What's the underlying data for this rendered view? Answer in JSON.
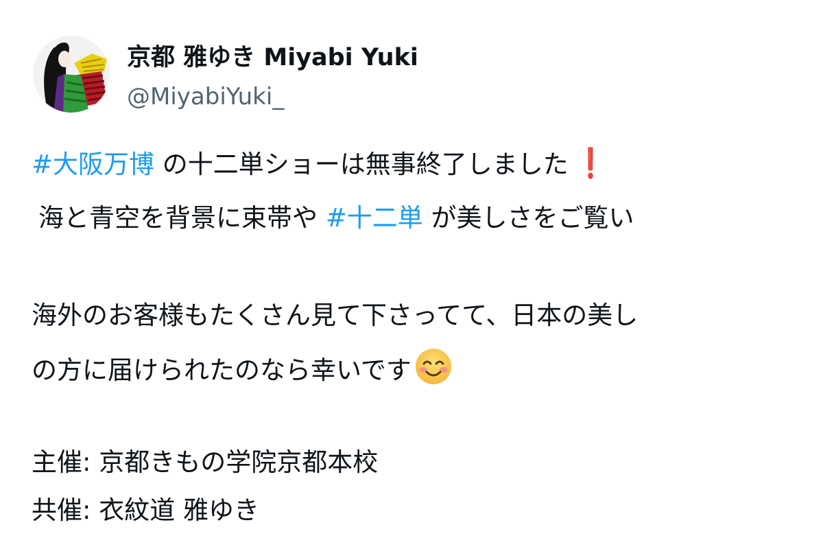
{
  "author": {
    "display_name": "京都 雅ゆき Miyabi Yuki",
    "handle": "@MiyabiYuki_"
  },
  "tweet": {
    "line1": {
      "hashtag": "#大阪万博",
      "text": " の十二単ショーは無事終了しました",
      "emoji": "❗"
    },
    "line2": {
      "text_before": "海と青空を背景に束帯や ",
      "hashtag": "#十二単",
      "text_after": " が美しさをご覧い"
    },
    "line3": "海外のお客様もたくさん見て下さってて、日本の美し",
    "line4": {
      "text": "の方に届けられたのなら幸いです",
      "emoji": "smiling-face-emoji"
    },
    "line5": "主催: 京都きもの学院京都本校",
    "line6": "共催: 衣紋道 雅ゆき"
  },
  "colors": {
    "hashtag": "#1d9bf0",
    "handle": "#536471",
    "text": "#0f1419",
    "exclamation": "#d4202c"
  }
}
